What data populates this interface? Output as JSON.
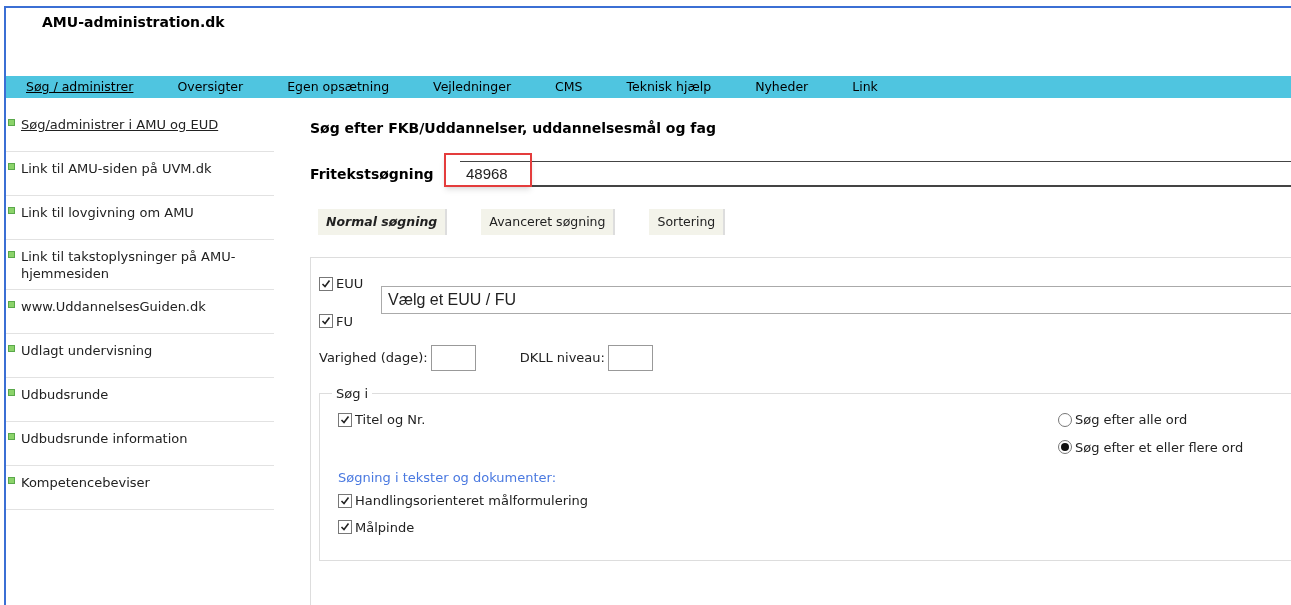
{
  "site_title": "AMU-administration.dk",
  "nav": [
    {
      "label": "Søg / administrer",
      "selected": true
    },
    {
      "label": "Oversigter",
      "selected": false
    },
    {
      "label": "Egen opsætning",
      "selected": false
    },
    {
      "label": "Vejledninger",
      "selected": false
    },
    {
      "label": "CMS",
      "selected": false
    },
    {
      "label": "Teknisk hjælp",
      "selected": false
    },
    {
      "label": "Nyheder",
      "selected": false
    },
    {
      "label": "Link",
      "selected": false
    }
  ],
  "sidebar": {
    "items": [
      {
        "label": "Søg/administrer i AMU og EUD",
        "selected": true
      },
      {
        "label": "Link til AMU-siden på UVM.dk",
        "selected": false
      },
      {
        "label": "Link til lovgivning om AMU",
        "selected": false
      },
      {
        "label": "Link til takstoplysninger på AMU-hjemmesiden",
        "selected": false
      },
      {
        "label": "www.UddannelsesGuiden.dk",
        "selected": false
      },
      {
        "label": "Udlagt undervisning",
        "selected": false
      },
      {
        "label": "Udbudsrunde",
        "selected": false
      },
      {
        "label": "Udbudsrunde information",
        "selected": false
      },
      {
        "label": "Kompetencebeviser",
        "selected": false
      }
    ]
  },
  "heading": "Søg efter FKB/Uddannelser, uddannelsesmål og fag",
  "free_text": {
    "label": "Fritekstsøgning",
    "value": "48968",
    "highlighted": true
  },
  "tabs": [
    {
      "label": "Normal søgning",
      "selected": true
    },
    {
      "label": "Avanceret søgning",
      "selected": false
    },
    {
      "label": "Sortering",
      "selected": false
    }
  ],
  "types": [
    {
      "label": "EUU",
      "checked": true
    },
    {
      "label": "FU",
      "checked": true
    }
  ],
  "education_select": {
    "value": "Vælg et EUU / FU"
  },
  "duration": {
    "label": "Varighed (dage):"
  },
  "dkll": {
    "label": "DKLL niveau:"
  },
  "search_in": {
    "legend": "Søg i",
    "fields": [
      {
        "label": "Titel og Nr.",
        "checked": true
      }
    ],
    "match": [
      {
        "label": "Søg efter alle ord",
        "selected": false
      },
      {
        "label": "Søg efter et eller flere ord",
        "selected": true
      }
    ],
    "documents_heading": "Søgning i tekster og dokumenter:",
    "documents": [
      {
        "label": "Handlingsorienteret målformulering",
        "checked": true
      },
      {
        "label": "Målpinde",
        "checked": true
      }
    ]
  }
}
